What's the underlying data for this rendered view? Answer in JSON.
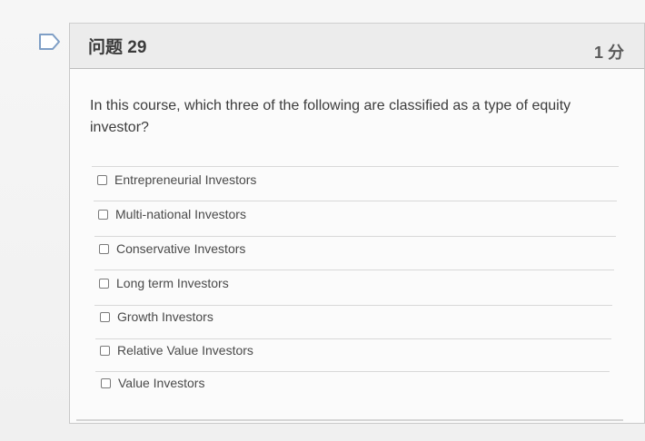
{
  "question": {
    "title": "问题 29",
    "points": "1 分",
    "text": "In this course, which three of the following are classified as a type of equity investor?"
  },
  "options": [
    {
      "label": "Entrepreneurial Investors",
      "checked": false
    },
    {
      "label": "Multi-national Investors",
      "checked": false
    },
    {
      "label": "Conservative Investors",
      "checked": false
    },
    {
      "label": "Long term Investors",
      "checked": false
    },
    {
      "label": "Growth Investors",
      "checked": false
    },
    {
      "label": "Relative Value Investors",
      "checked": false
    },
    {
      "label": "Value Investors",
      "checked": false
    }
  ],
  "colors": {
    "header_bg": "#ececec",
    "card_bg": "#fbfbfb",
    "flag_stroke": "#7f9fc6"
  },
  "icons": {
    "flag": "bookmark-flag-icon"
  }
}
